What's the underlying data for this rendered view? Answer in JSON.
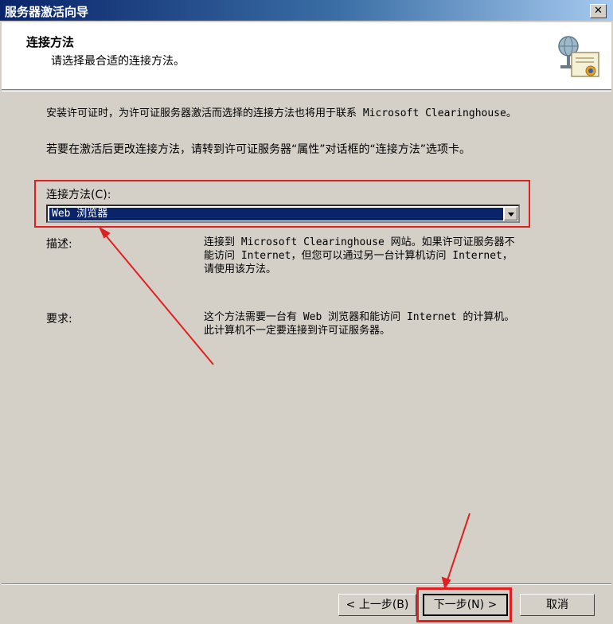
{
  "window": {
    "title": "服务器激活向导",
    "close_glyph": "✕"
  },
  "header": {
    "title": "连接方法",
    "subtitle": "请选择最合适的连接方法。"
  },
  "intro": {
    "line1": "安装许可证时，为许可证服务器激活而选择的连接方法也将用于联系 Microsoft Clearinghouse。",
    "line2": "若要在激活后更改连接方法，请转到许可证服务器“属性”对话框的“连接方法”选项卡。"
  },
  "method": {
    "label": "连接方法(C):",
    "selected": "Web 浏览器"
  },
  "description": {
    "label": "描述:",
    "text": "连接到 Microsoft Clearinghouse 网站。如果许可证服务器不能访问 Internet，但您可以通过另一台计算机访问 Internet，请使用该方法。"
  },
  "requirement": {
    "label": "要求:",
    "text": "这个方法需要一台有 Web 浏览器和能访问 Internet 的计算机。此计算机不一定要连接到许可证服务器。"
  },
  "buttons": {
    "back": "< 上一步(B)",
    "next": "下一步(N) >",
    "cancel": "取消"
  },
  "annotation_color": "#e02020"
}
